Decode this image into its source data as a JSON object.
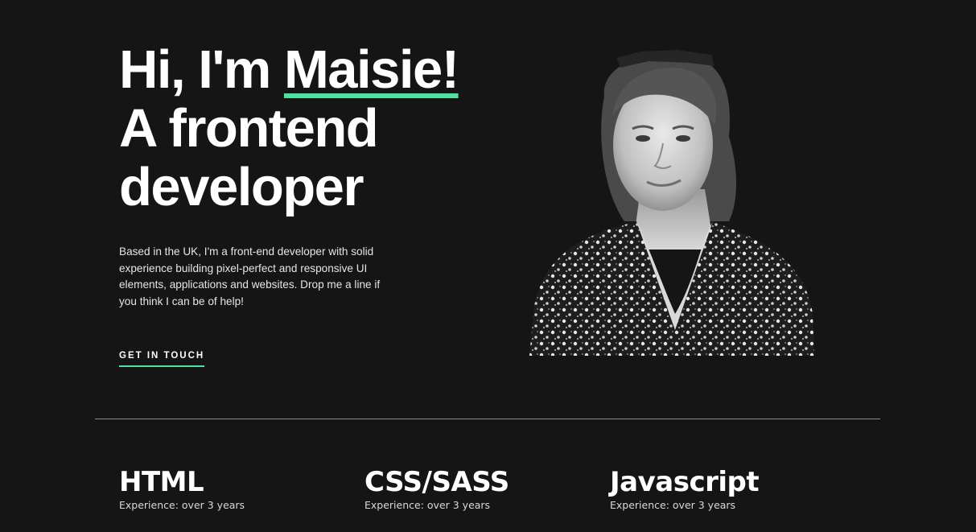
{
  "hero": {
    "greeting": "Hi, I'm ",
    "name": "Maisie!",
    "title_line2": "A frontend",
    "title_line3": "developer",
    "description": "Based in the UK, I'm a front-end developer with solid experience building pixel-perfect and responsive UI elements, applications and websites. Drop me a line if you think I can be of help!",
    "cta_label": "GET IN TOUCH"
  },
  "colors": {
    "accent": "#4ee1a0",
    "background": "#151515",
    "text": "#ffffff"
  },
  "skills": [
    {
      "name": "HTML",
      "experience": "Experience: over 3 years"
    },
    {
      "name": "CSS/SASS",
      "experience": "Experience: over 3 years"
    },
    {
      "name": "Javascript",
      "experience": "Experience: over 3 years"
    }
  ]
}
